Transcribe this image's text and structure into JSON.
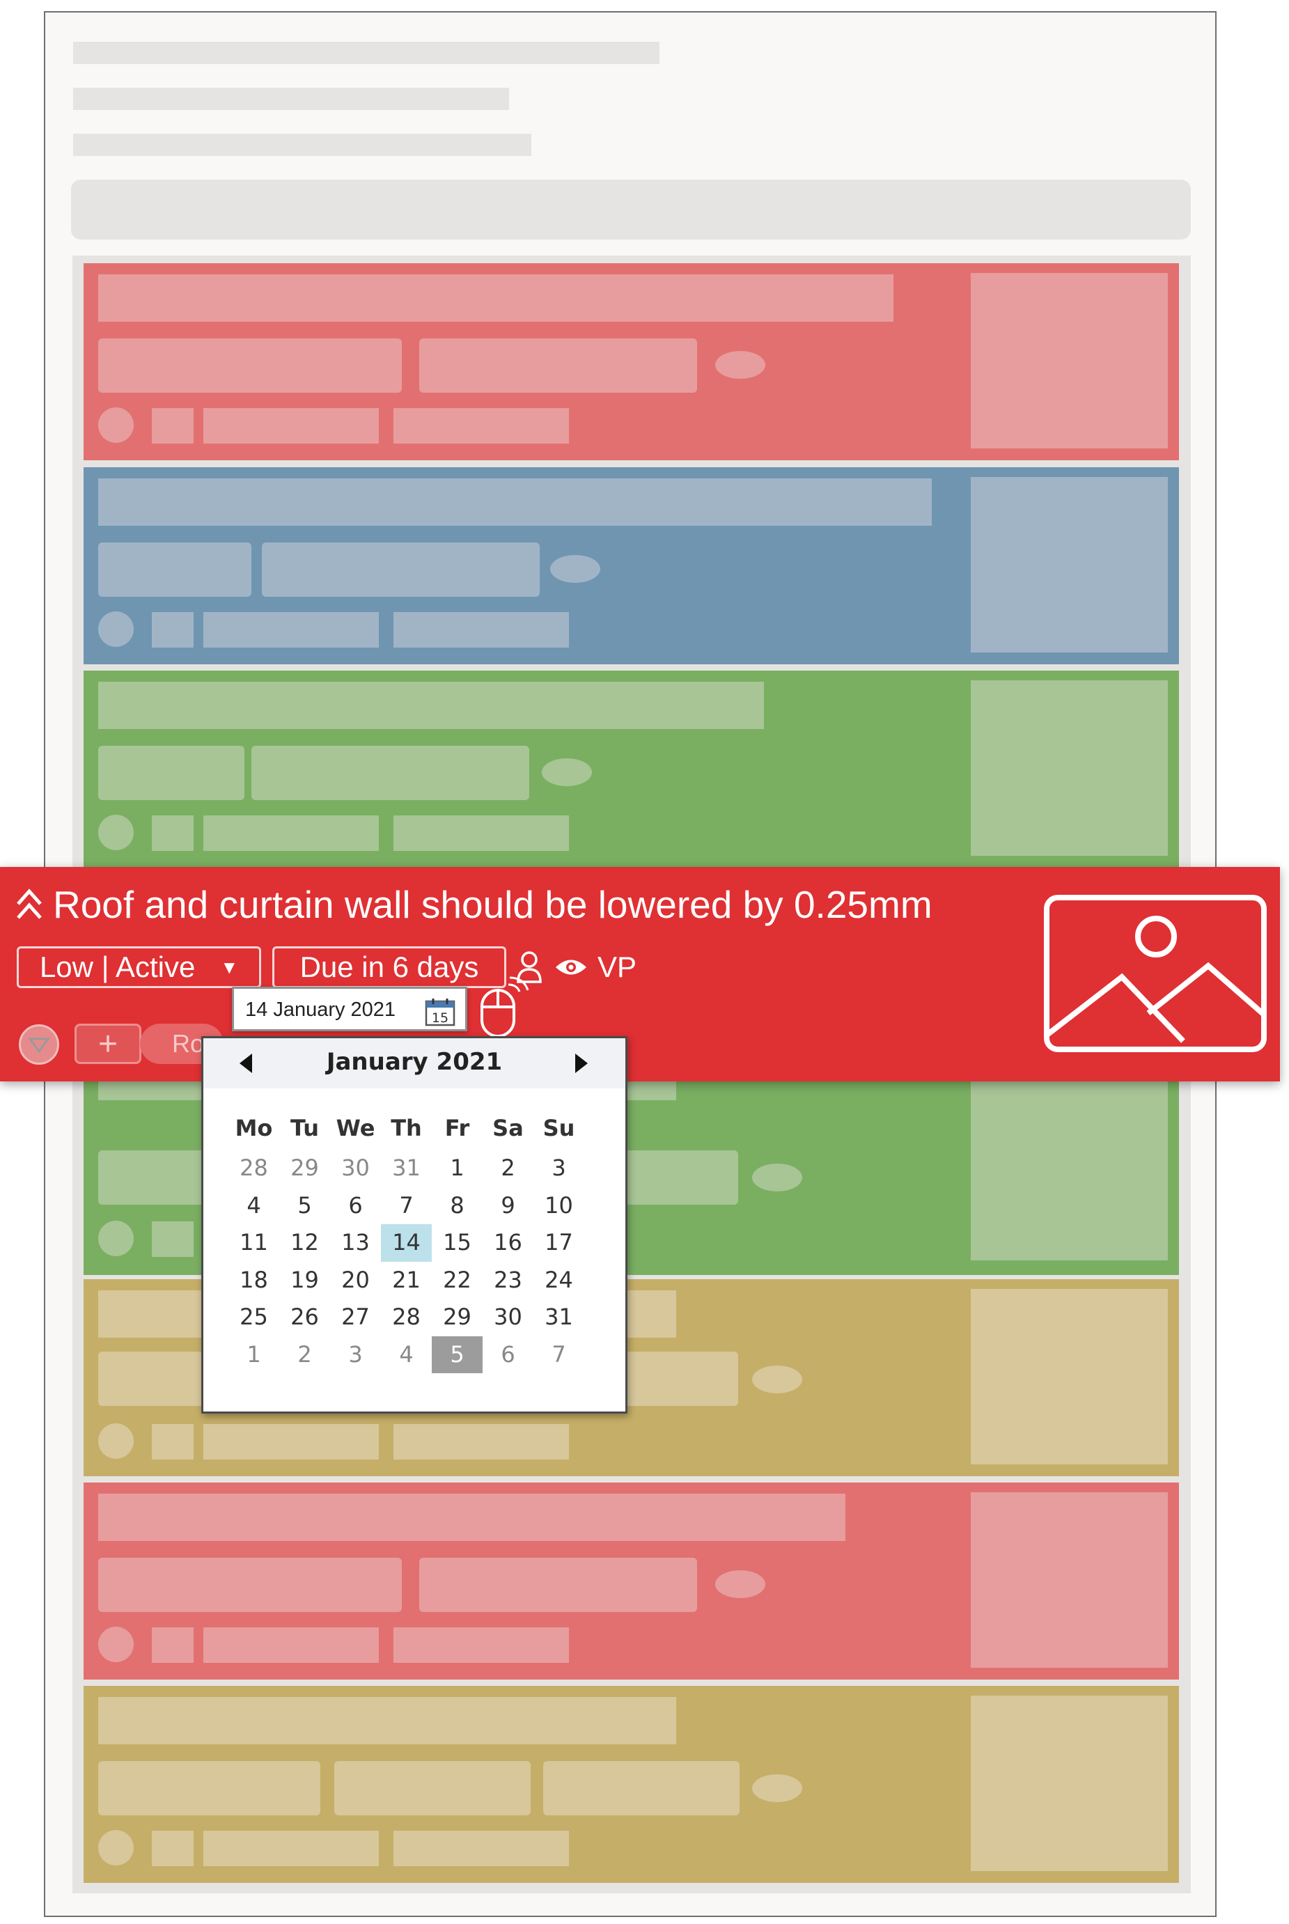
{
  "focused_task": {
    "title": "Roof and curtain wall should be lowered by 0.25mm",
    "status_dropdown": "Low | Active",
    "due": "Due in 6 days",
    "assignee": "VP",
    "tag_partial": "Ro",
    "icons": [
      "priority-chevrons-icon",
      "dropdown-arrow-icon",
      "person-icon",
      "eye-icon",
      "expand-toggle-icon",
      "plus-icon",
      "image-placeholder-icon"
    ],
    "colors": {
      "card": "#df3033",
      "border": "#f7d6d6"
    }
  },
  "date_picker": {
    "input_value": "14 January 2021",
    "calendar_icon_day": "15",
    "month_label": "January 2021",
    "weekdays": [
      "Mo",
      "Tu",
      "We",
      "Th",
      "Fr",
      "Sa",
      "Su"
    ],
    "weeks": [
      [
        "28",
        "29",
        "30",
        "31",
        "1",
        "2",
        "3"
      ],
      [
        "4",
        "5",
        "6",
        "7",
        "8",
        "9",
        "10"
      ],
      [
        "11",
        "12",
        "13",
        "14",
        "15",
        "16",
        "17"
      ],
      [
        "18",
        "19",
        "20",
        "21",
        "22",
        "23",
        "24"
      ],
      [
        "25",
        "26",
        "27",
        "28",
        "29",
        "30",
        "31"
      ],
      [
        "1",
        "2",
        "3",
        "4",
        "5",
        "6",
        "7"
      ]
    ],
    "selected": "14",
    "today": "5",
    "colors": {
      "selected": "#bde1ea",
      "today": "#9c9c9c"
    }
  },
  "background_cards": [
    {
      "color": "red"
    },
    {
      "color": "blue"
    },
    {
      "color": "green"
    },
    {
      "color": "green"
    },
    {
      "color": "yellow"
    },
    {
      "color": "red"
    },
    {
      "color": "yellow"
    }
  ],
  "palette": {
    "red": {
      "bg": "#e27070",
      "el": "#e79d9d"
    },
    "blue": {
      "bg": "#6f95b1",
      "el": "#a1b4c5"
    },
    "green": {
      "bg": "#7aaf62",
      "el": "#a8c596"
    },
    "yellow": {
      "bg": "#c5ae67",
      "el": "#d7c79b"
    }
  }
}
